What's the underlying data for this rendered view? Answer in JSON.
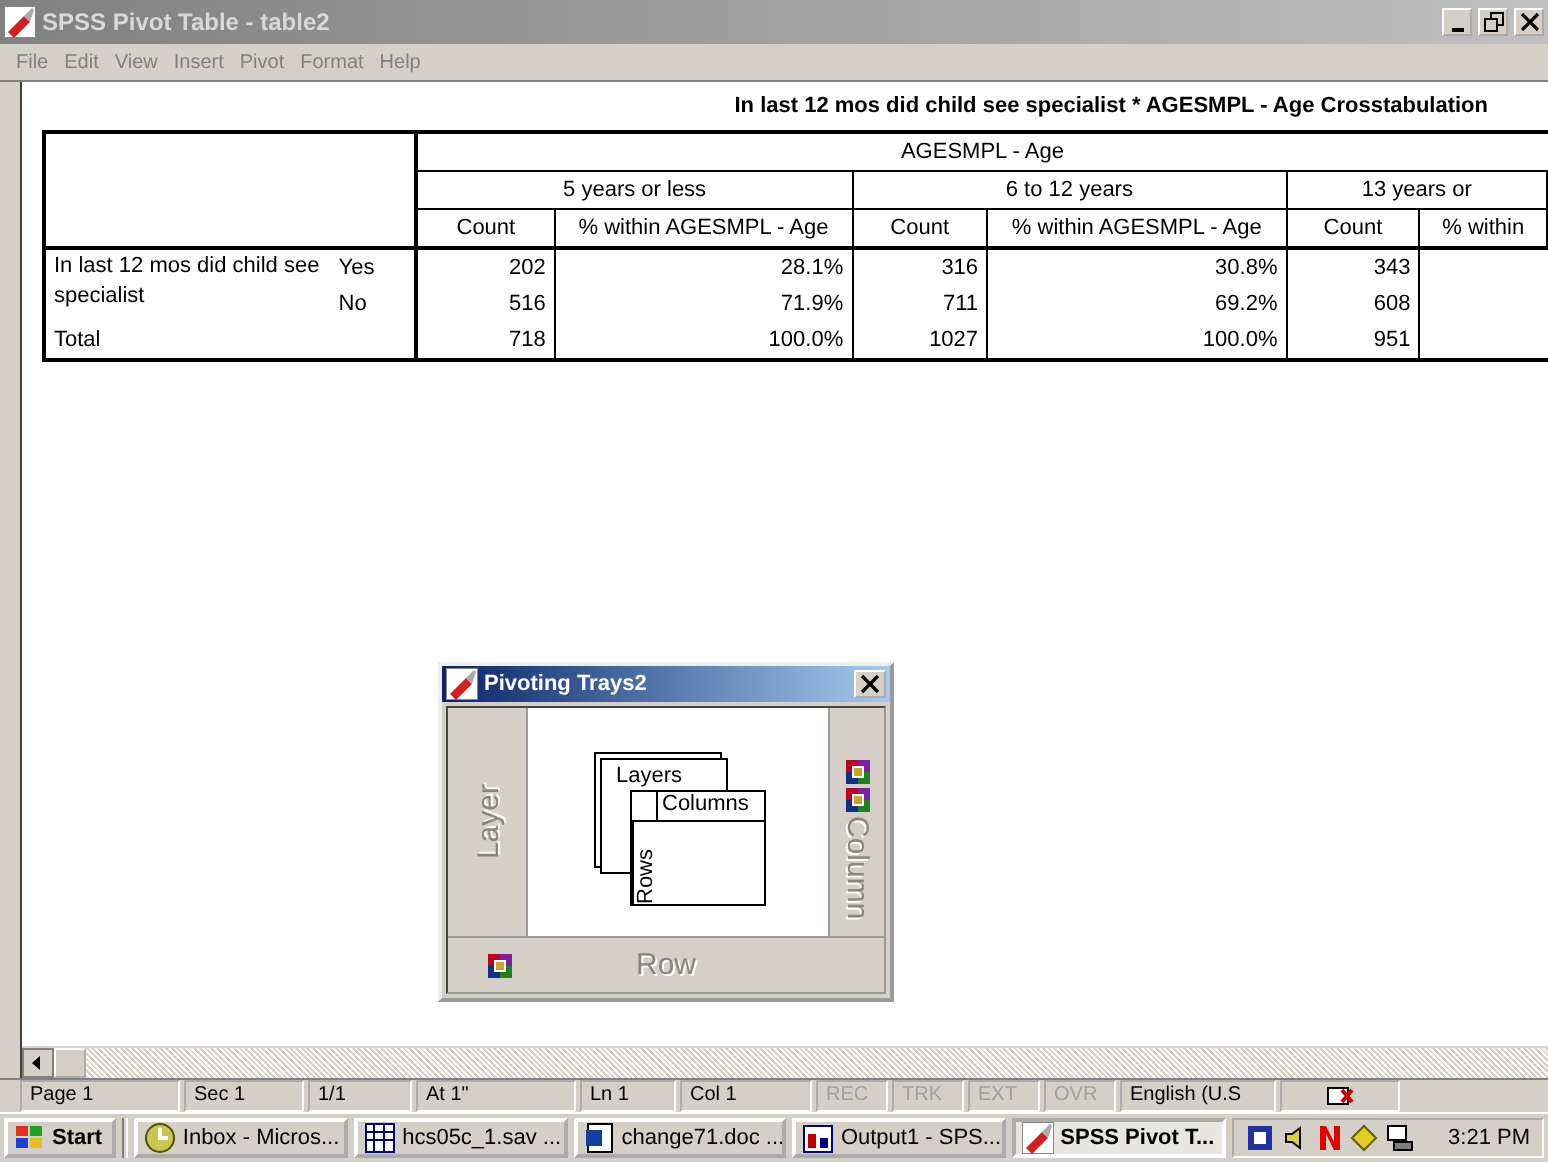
{
  "window": {
    "title": "SPSS Pivot Table - table2"
  },
  "menu": [
    "File",
    "Edit",
    "View",
    "Insert",
    "Pivot",
    "Format",
    "Help"
  ],
  "table": {
    "title": "In last 12 mos did child see specialist * AGESMPL - Age Crosstabulation",
    "column_variable": "AGESMPL - Age",
    "groups": [
      {
        "label": "5 years or less",
        "columns": [
          "Count",
          "% within AGESMPL - Age"
        ]
      },
      {
        "label": "6 to 12 years",
        "columns": [
          "Count",
          "% within AGESMPL - Age"
        ]
      },
      {
        "label": "13 years or",
        "columns": [
          "Count",
          "% within"
        ]
      }
    ],
    "row_variable": "In last 12 mos did child see specialist",
    "rows": [
      {
        "category": "Yes",
        "cells": [
          "202",
          "28.1%",
          "316",
          "30.8%",
          "343"
        ]
      },
      {
        "category": "No",
        "cells": [
          "516",
          "71.9%",
          "711",
          "69.2%",
          "608"
        ]
      }
    ],
    "total": {
      "label": "Total",
      "cells": [
        "718",
        "100.0%",
        "1027",
        "100.0%",
        "951"
      ]
    }
  },
  "trays_dialog": {
    "title": "Pivoting Trays2",
    "layer_tray": "Layer",
    "column_tray": "Column",
    "row_tray": "Row",
    "diagram": {
      "layers": "Layers",
      "columns": "Columns",
      "rows": "Rows"
    }
  },
  "status_bar": [
    {
      "text": "Page 1",
      "disabled": false
    },
    {
      "text": "Sec 1",
      "disabled": false
    },
    {
      "text": "1/1",
      "disabled": false
    },
    {
      "text": "At 1\"",
      "disabled": false
    },
    {
      "text": "Ln 1",
      "disabled": false
    },
    {
      "text": "Col 1",
      "disabled": false
    },
    {
      "text": "REC",
      "disabled": true
    },
    {
      "text": "TRK",
      "disabled": true
    },
    {
      "text": "EXT",
      "disabled": true
    },
    {
      "text": "OVR",
      "disabled": true
    },
    {
      "text": "English (U.S",
      "disabled": false
    }
  ],
  "taskbar": {
    "start": "Start",
    "tasks": [
      {
        "label": "Inbox - Micros...",
        "kind": "mail",
        "selected": false
      },
      {
        "label": "hcs05c_1.sav ...",
        "kind": "data",
        "selected": false
      },
      {
        "label": "change71.doc ...",
        "kind": "word",
        "selected": false
      },
      {
        "label": "Output1 - SPS...",
        "kind": "output",
        "selected": false
      },
      {
        "label": "SPSS Pivot T...",
        "kind": "pivot",
        "selected": true
      }
    ],
    "clock": "3:21 PM"
  }
}
